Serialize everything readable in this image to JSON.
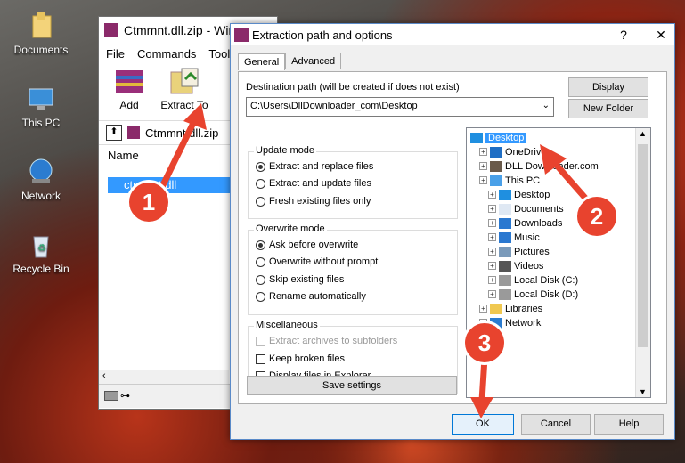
{
  "desktop": {
    "icons": [
      {
        "label": "Documents",
        "icon": "documents-folder-icon"
      },
      {
        "label": "This PC",
        "icon": "computer-icon"
      },
      {
        "label": "Network",
        "icon": "network-icon"
      },
      {
        "label": "Recycle Bin",
        "icon": "recycle-bin-icon"
      }
    ]
  },
  "winrar": {
    "title": "Ctmmnt.dll.zip - WinR",
    "menu": [
      "File",
      "Commands",
      "Tools"
    ],
    "toolbar": {
      "add": "Add",
      "extract_to": "Extract To"
    },
    "address": "Ctmmnt.dll.zip",
    "list_header": "Name",
    "file": "ctmmnt.dll"
  },
  "dialog": {
    "title": "Extraction path and options",
    "help_symbol": "?",
    "close_symbol": "✕",
    "tabs": [
      "General",
      "Advanced"
    ],
    "dest_label": "Destination path (will be created if does not exist)",
    "dest_value": "C:\\Users\\DllDownloader_com\\Desktop",
    "display_button": "Display",
    "new_folder_button": "New Folder",
    "update_mode": {
      "title": "Update mode",
      "options": [
        "Extract and replace files",
        "Extract and update files",
        "Fresh existing files only"
      ],
      "selected": 0
    },
    "overwrite_mode": {
      "title": "Overwrite mode",
      "options": [
        "Ask before overwrite",
        "Overwrite without prompt",
        "Skip existing files",
        "Rename automatically"
      ],
      "selected": 0
    },
    "misc": {
      "title": "Miscellaneous",
      "options": [
        "Extract archives to subfolders",
        "Keep broken files",
        "Display files in Explorer"
      ]
    },
    "save_settings": "Save settings",
    "tree": [
      {
        "label": "Desktop",
        "icon": "desktop-icon",
        "selected": true
      },
      {
        "label": "OneDrive",
        "icon": "onedrive-icon"
      },
      {
        "label": "DLL Downloader.com",
        "icon": "user-icon"
      },
      {
        "label": "This PC",
        "icon": "computer-icon"
      },
      {
        "label": "Desktop",
        "icon": "desktop-icon"
      },
      {
        "label": "Documents",
        "icon": "documents-icon"
      },
      {
        "label": "Downloads",
        "icon": "downloads-icon"
      },
      {
        "label": "Music",
        "icon": "music-icon"
      },
      {
        "label": "Pictures",
        "icon": "pictures-icon"
      },
      {
        "label": "Videos",
        "icon": "videos-icon"
      },
      {
        "label": "Local Disk (C:)",
        "icon": "drive-icon"
      },
      {
        "label": "Local Disk (D:)",
        "icon": "drive-icon"
      },
      {
        "label": "Libraries",
        "icon": "libraries-icon"
      },
      {
        "label": "Network",
        "icon": "network-icon"
      }
    ],
    "ok": "OK",
    "cancel": "Cancel",
    "help": "Help"
  },
  "annotations": [
    "1",
    "2",
    "3"
  ],
  "colors": {
    "badge": "#e8432e",
    "selection": "#3399ff",
    "dialog_border": "#5a8ac8"
  }
}
